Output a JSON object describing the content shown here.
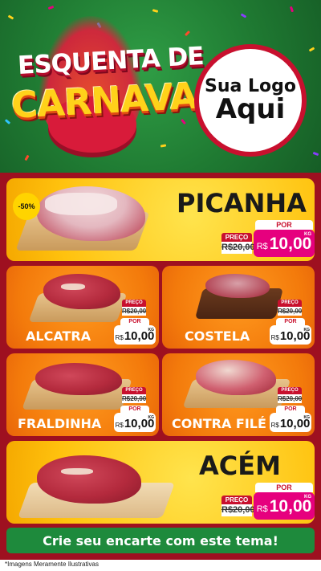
{
  "header": {
    "title_line1": "ESQUENTA DE",
    "title_line2": "CARNAVAL",
    "logo_line1": "Sua Logo",
    "logo_line2": "Aqui"
  },
  "products": [
    {
      "name": "PICANHA",
      "discount": "-50%",
      "preco_label": "PREÇO",
      "old_price": "R$20,00",
      "por_label": "POR",
      "currency": "R$",
      "price": "10,00",
      "unit": "KG"
    },
    {
      "name": "ALCATRA",
      "preco_label": "PREÇO",
      "old_price": "R$20,00",
      "por_label": "POR",
      "currency": "R$",
      "price": "10,00",
      "unit": "KG"
    },
    {
      "name": "COSTELA",
      "preco_label": "PREÇO",
      "old_price": "R$20,00",
      "por_label": "POR",
      "currency": "R$",
      "price": "10,00",
      "unit": "KG"
    },
    {
      "name": "FRALDINHA",
      "preco_label": "PREÇO",
      "old_price": "R$20,00",
      "por_label": "POR",
      "currency": "R$",
      "price": "10,00",
      "unit": "KG"
    },
    {
      "name": "CONTRA FILÉ",
      "preco_label": "PREÇO",
      "old_price": "R$20,00",
      "por_label": "POR",
      "currency": "R$",
      "price": "10,00",
      "unit": "KG"
    },
    {
      "name": "ACÉM",
      "preco_label": "PREÇO",
      "old_price": "R$20,00",
      "por_label": "POR",
      "currency": "R$",
      "price": "10,00",
      "unit": "KG"
    }
  ],
  "banner": {
    "text": "Crie seu encarte com este tema!"
  },
  "footer": {
    "note": "*Imagens Meramente Ilustrativas"
  },
  "colors": {
    "green": "#1e8a3c",
    "red": "#c8102e",
    "magenta": "#e6007e",
    "yellow": "#ffc20e",
    "orange": "#f37a0b",
    "maroon": "#9e1020"
  }
}
